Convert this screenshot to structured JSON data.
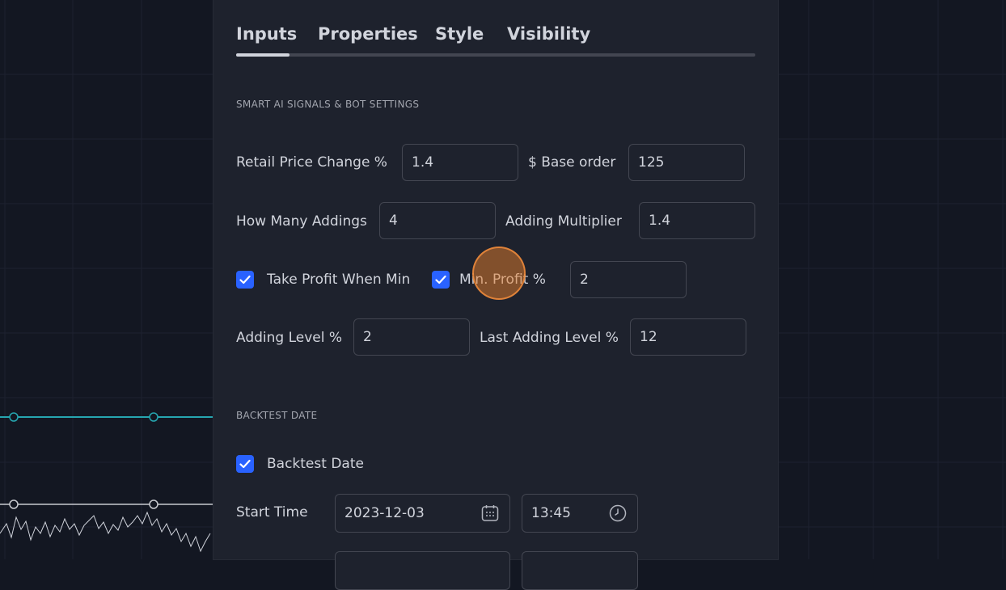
{
  "tabs": [
    {
      "label": "Inputs",
      "active": true
    },
    {
      "label": "Properties",
      "active": false
    },
    {
      "label": "Style",
      "active": false
    },
    {
      "label": "Visibility",
      "active": false
    }
  ],
  "sections": {
    "smart_ai": "SMART AI SIGNALS & BOT SETTINGS",
    "backtest": "BACKTEST DATE"
  },
  "inputs": {
    "retail_price_change": {
      "label": "Retail Price Change %",
      "value": "1.4"
    },
    "base_order": {
      "label": "$ Base order",
      "value": "125"
    },
    "how_many_addings": {
      "label": "How Many Addings",
      "value": "4"
    },
    "adding_multiplier": {
      "label": "Adding Multiplier",
      "value": "1.4"
    },
    "take_profit_when_min": {
      "label": "Take Profit When Min",
      "checked": true
    },
    "min_profit": {
      "label": "Min. Profit %",
      "checked": true,
      "value": "2"
    },
    "adding_level": {
      "label": "Adding Level %",
      "value": "2"
    },
    "last_adding_level": {
      "label": "Last Adding Level %",
      "value": "12"
    },
    "backtest_date": {
      "label": "Backtest Date",
      "checked": true
    },
    "start_time": {
      "label": "Start Time",
      "date": "2023-12-03",
      "time": "13:45"
    }
  },
  "colors": {
    "accent": "#2962ff",
    "panel": "#1e222d",
    "chart_bg": "#131722",
    "line_teal": "#26a6b0"
  },
  "icons": [
    "check-icon",
    "calendar-icon",
    "clock-icon"
  ]
}
